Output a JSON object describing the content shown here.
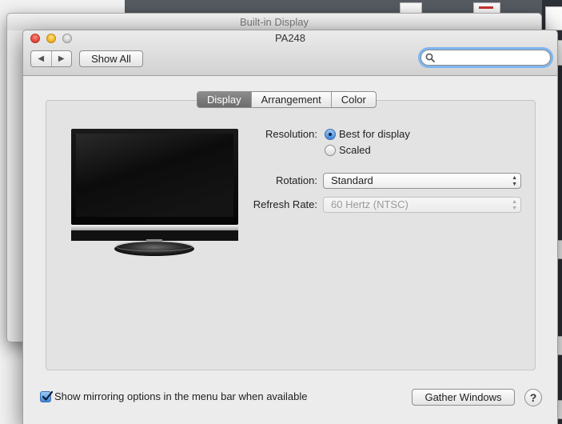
{
  "background_window": {
    "title": "Built-in Display"
  },
  "window": {
    "title": "PA248"
  },
  "toolbar": {
    "back_glyph": "◀",
    "forward_glyph": "▶",
    "show_all_label": "Show All",
    "search_placeholder": "",
    "search_value": ""
  },
  "tabs": [
    {
      "label": "Display",
      "active": true
    },
    {
      "label": "Arrangement",
      "active": false
    },
    {
      "label": "Color",
      "active": false
    }
  ],
  "display": {
    "resolution_label": "Resolution:",
    "resolution_options": [
      {
        "label": "Best for display",
        "selected": true
      },
      {
        "label": "Scaled",
        "selected": false
      }
    ],
    "rotation_label": "Rotation:",
    "rotation_value": "Standard",
    "refresh_label": "Refresh Rate:",
    "refresh_value": "60 Hertz (NTSC)",
    "refresh_enabled": false
  },
  "bottom": {
    "mirroring_label": "Show mirroring options in the menu bar when available",
    "mirroring_checked": true,
    "gather_label": "Gather Windows",
    "help_glyph": "?"
  },
  "colors": {
    "accent": "#3f86d8",
    "focus_ring": "#7db6ef",
    "active_tab": "#7a7a7a"
  }
}
